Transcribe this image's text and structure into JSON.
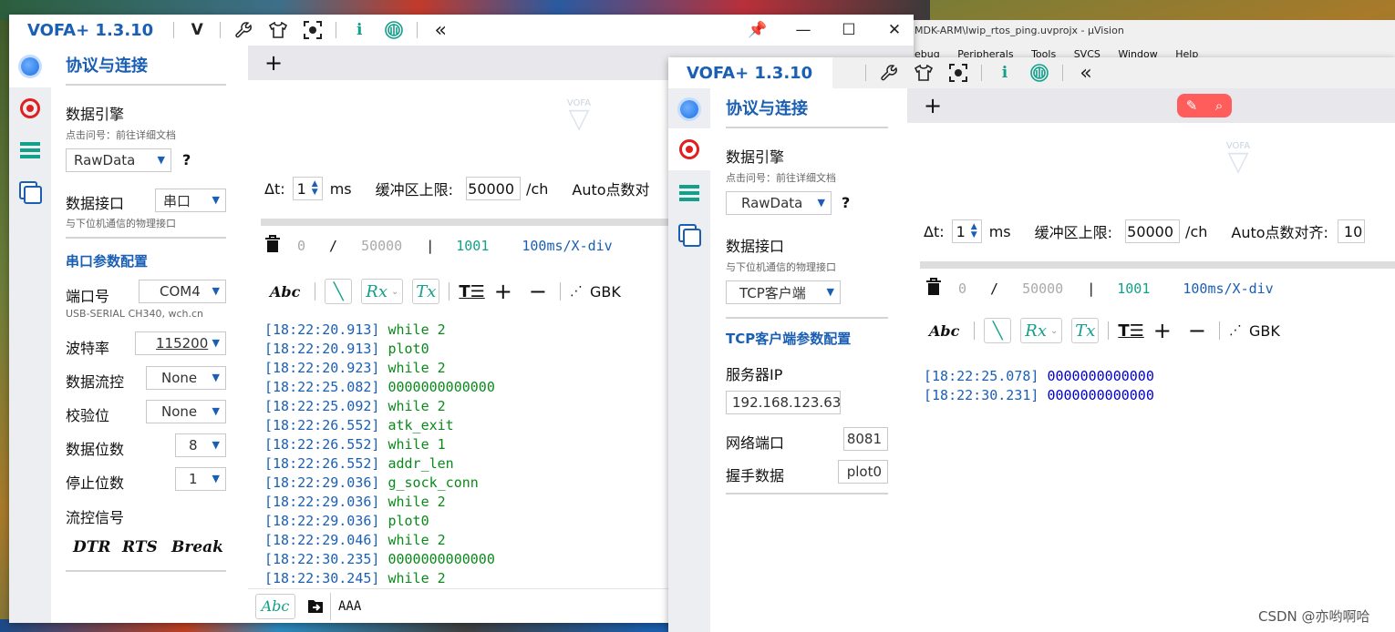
{
  "background": {
    "uvision_title": "MDK-ARM\\lwip_rtos_ping.uvprojx - µVision",
    "uvision_menu": [
      "ebug",
      "Peripherals",
      "Tools",
      "SVCS",
      "Window",
      "Help"
    ],
    "watermark": "CSDN @亦哟啊哈"
  },
  "icons": {
    "logo_mark": "V",
    "wrench": "wrench-icon",
    "shirt": "tshirt-icon",
    "capture": "screen-capture-icon",
    "info": "i",
    "fingerprint": "fingerprint-icon",
    "collapse": "«"
  },
  "win1": {
    "app_title": "VOFA+ 1.3.10",
    "window_controls": [
      "📌",
      "—",
      "☐",
      "✕"
    ],
    "panel": {
      "heading": "协议与连接",
      "engine_label": "数据引擎",
      "engine_hint": "点击问号：前往详细文档",
      "engine_value": "RawData",
      "help": "?",
      "interface_label": "数据接口",
      "interface_value": "串口",
      "interface_hint": "与下位机通信的物理接口",
      "serial_heading": "串口参数配置",
      "port_label": "端口号",
      "port_value": "COM4",
      "port_desc": "USB-SERIAL CH340, wch.cn",
      "baud_label": "波特率",
      "baud_value": "115200",
      "flow_label": "数据流控",
      "flow_value": "None",
      "parity_label": "校验位",
      "parity_value": "None",
      "databits_label": "数据位数",
      "databits_value": "8",
      "stopbits_label": "停止位数",
      "stopbits_value": "1",
      "signal_label": "流控信号",
      "signals": [
        "DTR",
        "RTS",
        "Break"
      ]
    },
    "main": {
      "add_tab": "+",
      "watermark": "VOFA",
      "dt_label": "Δt:",
      "dt_value": "1",
      "dt_unit": "ms",
      "buffer_label": "缓冲区上限:",
      "buffer_value": "50000",
      "buffer_unit": "/ch",
      "auto_label": "Auto点数对",
      "count_current": "0",
      "count_sep": "/",
      "count_max": "50000",
      "bar": "|",
      "count_points": "1001",
      "time_div": "100ms/X-div",
      "abc": "Abc",
      "rx": "Rx",
      "tx": "Tx",
      "plus": "+",
      "minus": "−",
      "encoding": "GBK",
      "log": [
        {
          "ts": "[18:22:20.913]",
          "msg": "while 2"
        },
        {
          "ts": "[18:22:20.913]",
          "msg": "plot0"
        },
        {
          "ts": "[18:22:20.923]",
          "msg": "while 2"
        },
        {
          "ts": "[18:22:25.082]",
          "msg": "0000000000000"
        },
        {
          "ts": "[18:22:25.092]",
          "msg": "while 2"
        },
        {
          "ts": "[18:22:26.552]",
          "msg": "atk_exit"
        },
        {
          "ts": "[18:22:26.552]",
          "msg": "while 1"
        },
        {
          "ts": "[18:22:26.552]",
          "msg": "addr_len"
        },
        {
          "ts": "[18:22:29.036]",
          "msg": "g_sock_conn"
        },
        {
          "ts": "[18:22:29.036]",
          "msg": "while 2"
        },
        {
          "ts": "[18:22:29.036]",
          "msg": "plot0"
        },
        {
          "ts": "[18:22:29.046]",
          "msg": "while 2"
        },
        {
          "ts": "[18:22:30.235]",
          "msg": "0000000000000"
        },
        {
          "ts": "[18:22:30.245]",
          "msg": "while 2"
        }
      ],
      "send_mode": "Abc",
      "send_text": "AAA"
    }
  },
  "win2": {
    "app_title": "VOFA+ 1.3.10",
    "panel": {
      "heading": "协议与连接",
      "engine_label": "数据引擎",
      "engine_hint": "点击问号：前往详细文档",
      "engine_value": "RawData",
      "help": "?",
      "interface_label": "数据接口",
      "interface_hint": "与下位机通信的物理接口",
      "interface_value": "TCP客户端",
      "tcp_heading": "TCP客户端参数配置",
      "server_ip_label": "服务器IP",
      "server_ip_value": "192.168.123.63",
      "port_label": "网络端口",
      "port_value": "8081",
      "handshake_label": "握手数据",
      "handshake_value": "plot0"
    },
    "main": {
      "add_tab": "+",
      "watermark": "VOFA",
      "dt_label": "Δt:",
      "dt_value": "1",
      "dt_unit": "ms",
      "buffer_label": "缓冲区上限:",
      "buffer_value": "50000",
      "buffer_unit": "/ch",
      "auto_label": "Auto点数对齐:",
      "auto_value": "10",
      "count_current": "0",
      "count_sep": "/",
      "count_max": "50000",
      "bar": "|",
      "count_points": "1001",
      "time_div": "100ms/X-div",
      "abc": "Abc",
      "rx": "Rx",
      "tx": "Tx",
      "plus": "+",
      "minus": "−",
      "encoding": "GBK",
      "log": [
        {
          "ts": "[18:22:25.078]",
          "msg": "0000000000000"
        },
        {
          "ts": "[18:22:30.231]",
          "msg": "0000000000000"
        }
      ]
    }
  }
}
